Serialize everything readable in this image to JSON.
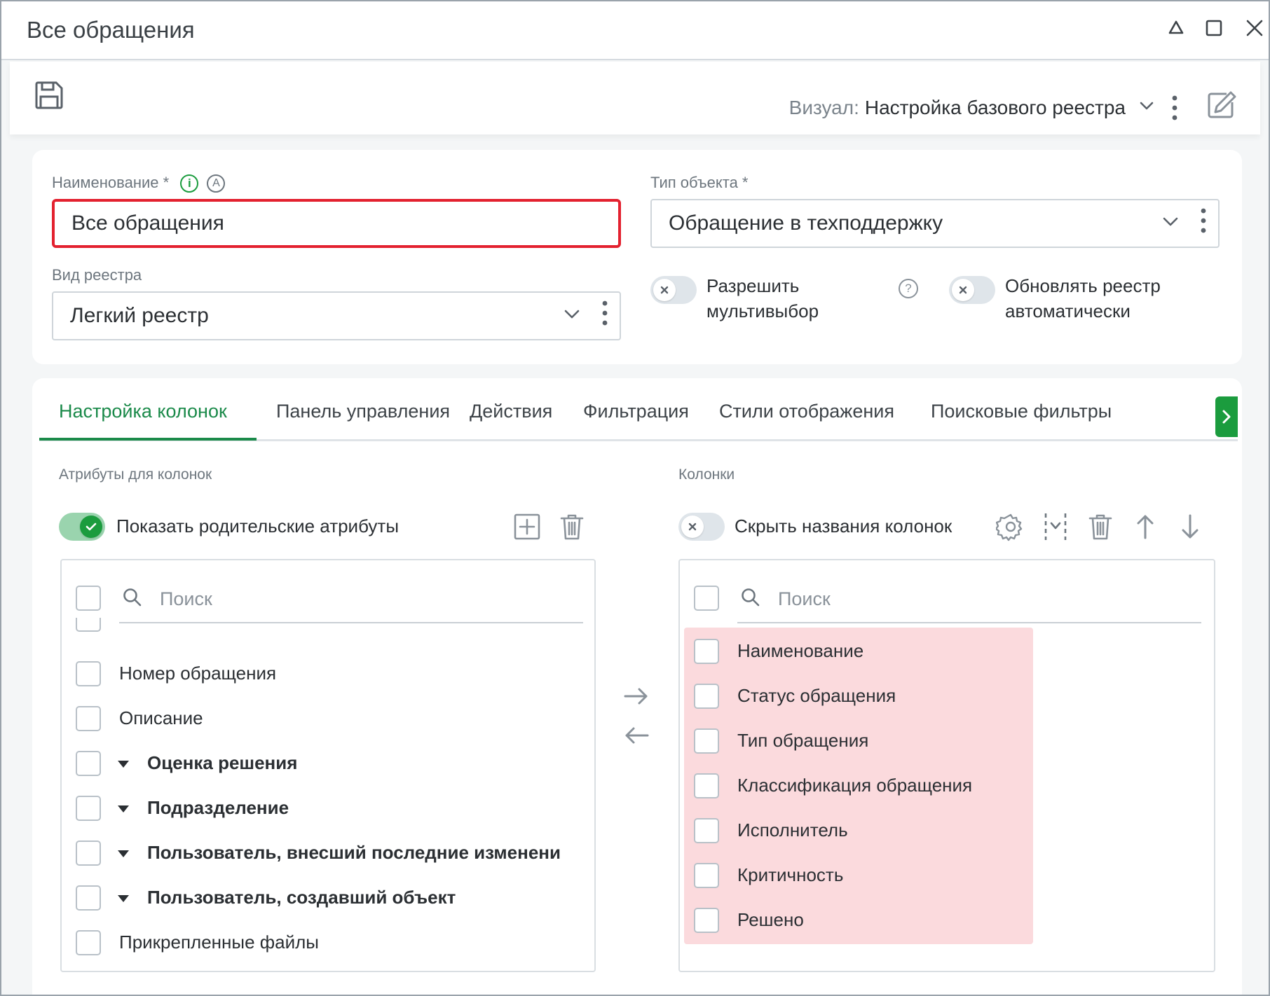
{
  "window": {
    "title": "Все обращения",
    "controls": [
      "minimize-icon",
      "maximize-icon",
      "close-icon"
    ]
  },
  "toolbar": {
    "visual_label": "Визуал:",
    "visual_value": "Настройка базового реестра"
  },
  "form": {
    "name_label": "Наименование *",
    "name_value": "Все обращения",
    "object_type_label": "Тип объекта *",
    "object_type_value": "Обращение в техподдержку",
    "registry_kind_label": "Вид реестра",
    "registry_kind_value": "Легкий реестр",
    "multiselect_label_line1": "Разрешить",
    "multiselect_label_line2": "мультивыбор",
    "multiselect_on": false,
    "autorefresh_label_line1": "Обновлять реестр",
    "autorefresh_label_line2": "автоматически",
    "autorefresh_on": false,
    "info_badge": "i",
    "auto_badge": "A",
    "help_badge": "?"
  },
  "tabs": [
    {
      "label": "Настройка колонок",
      "active": true
    },
    {
      "label": "Панель управления",
      "active": false
    },
    {
      "label": "Действия",
      "active": false
    },
    {
      "label": "Фильтрация",
      "active": false
    },
    {
      "label": "Стили отображения",
      "active": false
    },
    {
      "label": "Поисковые фильтры",
      "active": false
    }
  ],
  "attributes": {
    "section_label": "Атрибуты для колонок",
    "show_parent_label": "Показать родительские атрибуты",
    "show_parent_on": true,
    "search_placeholder": "Поиск",
    "items": [
      {
        "label": "Номер обращения",
        "group": false
      },
      {
        "label": "Описание",
        "group": false
      },
      {
        "label": "Оценка решения",
        "group": true
      },
      {
        "label": "Подразделение",
        "group": true
      },
      {
        "label": "Пользователь, внесший последние изменени",
        "group": true
      },
      {
        "label": "Пользователь, создавший объект",
        "group": true
      },
      {
        "label": "Прикрепленные файлы",
        "group": false
      }
    ]
  },
  "columns": {
    "section_label": "Колонки",
    "hide_names_label": "Скрыть названия колонок",
    "hide_names_on": false,
    "search_placeholder": "Поиск",
    "items": [
      "Наименование",
      "Статус обращения",
      "Тип обращения",
      "Классификация обращения",
      "Исполнитель",
      "Критичность",
      "Решено"
    ],
    "highlight_color": "#fbdadd"
  },
  "colors": {
    "accent": "#1b9c3e",
    "error": "#e3212f"
  }
}
